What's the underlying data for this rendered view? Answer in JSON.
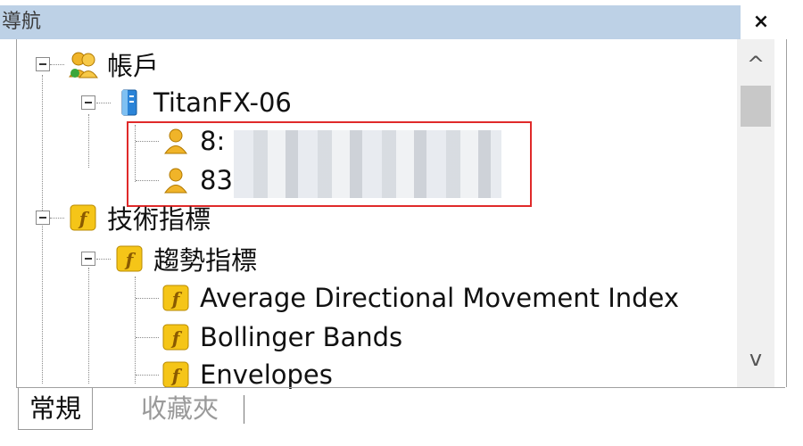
{
  "window": {
    "title": "導航",
    "close_label": "×"
  },
  "tree": {
    "account_root": "帳戶",
    "server": "TitanFX-06",
    "accounts": [
      "8:",
      "83"
    ],
    "indicators_root": "技術指標",
    "trend_folder": "趨勢指標",
    "trend_items": [
      "Average Directional Movement Index",
      "Bollinger Bands",
      "Envelopes"
    ]
  },
  "scroll": {
    "up": "^",
    "down": "v"
  },
  "tabs": {
    "active": "常規",
    "inactive": "收藏夾"
  },
  "colors": {
    "title_band": "#bdd1e6",
    "highlight_box": "#e02a2a",
    "indicator_icon": "#f5c518",
    "server_icon": "#2b84d8"
  }
}
